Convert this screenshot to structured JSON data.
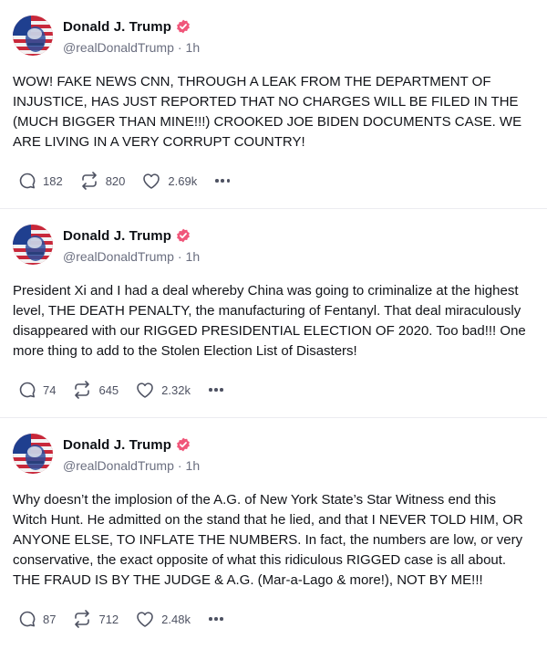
{
  "colors": {
    "verified_badge": "#f0567a",
    "text": "#111318",
    "muted": "#6b6f80",
    "icon": "#4e5262"
  },
  "icons": {
    "reply": "speech-bubble-icon",
    "retruth": "repost-arrows-icon",
    "like": "heart-icon",
    "more": "ellipsis-icon",
    "verified": "verified-badge-icon"
  },
  "posts": [
    {
      "author": "Donald J. Trump",
      "handle": "@realDonaldTrump",
      "separator": "·",
      "time": "1h",
      "text": "WOW! FAKE NEWS CNN, THROUGH A LEAK FROM THE DEPARTMENT OF INJUSTICE, HAS JUST REPORTED THAT NO CHARGES WILL BE FILED IN THE (MUCH BIGGER THAN MINE!!!) CROOKED JOE BIDEN DOCUMENTS CASE. WE ARE LIVING IN A VERY CORRUPT COUNTRY!",
      "replies": "182",
      "retruths": "820",
      "likes": "2.69k"
    },
    {
      "author": "Donald J. Trump",
      "handle": "@realDonaldTrump",
      "separator": "·",
      "time": "1h",
      "text": "President Xi and I had a deal whereby China was going to criminalize at the highest level, THE DEATH PENALTY, the manufacturing of Fentanyl. That deal miraculously disappeared with our RIGGED PRESIDENTIAL ELECTION OF 2020. Too bad!!! One more thing to add to the Stolen Election List of Disasters!",
      "replies": "74",
      "retruths": "645",
      "likes": "2.32k"
    },
    {
      "author": "Donald J. Trump",
      "handle": "@realDonaldTrump",
      "separator": "·",
      "time": "1h",
      "text": "Why doesn’t the implosion of the A.G. of New York State’s Star Witness end this Witch Hunt. He admitted on the stand that he lied, and that I NEVER TOLD HIM, OR ANYONE ELSE, TO INFLATE THE NUMBERS. In fact, the numbers are low, or very conservative, the exact opposite of what this ridiculous RIGGED case is all about. THE FRAUD IS BY THE JUDGE & A.G. (Mar-a-Lago & more!), NOT BY ME!!!",
      "replies": "87",
      "retruths": "712",
      "likes": "2.48k"
    }
  ]
}
